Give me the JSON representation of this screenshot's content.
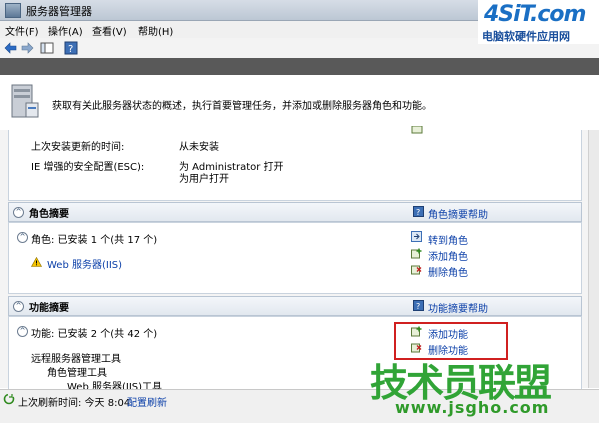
{
  "window": {
    "title": "服务器管理器"
  },
  "menu": {
    "items": [
      "文件(F)",
      "操作(A)",
      "查看(V)",
      "帮助(H)"
    ]
  },
  "logo": {
    "main": "4SiT.com",
    "sub": "电脑软硬件应用网"
  },
  "description": "获取有关此服务器状态的概述，执行首要管理任务，并添加或删除服务器角色和功能。",
  "security": {
    "last_update_label": "上次安装更新的时间:",
    "last_update_value": "从未安装",
    "ie_esc_label": "IE 增强的安全配置(ESC):",
    "ie_esc_value_line1": "为 Administrator 打开",
    "ie_esc_value_line2": "为用户打开"
  },
  "roles": {
    "header": "角色摘要",
    "help_link": "角色摘要帮助",
    "count_text": "角色: 已安装 1 个(共 17 个)",
    "items": [
      "Web 服务器(IIS)"
    ],
    "actions": [
      "转到角色",
      "添加角色",
      "删除角色"
    ]
  },
  "features": {
    "header": "功能摘要",
    "help_link": "功能摘要帮助",
    "count_text": "功能: 已安装 2 个(共 42 个)",
    "items": [
      "远程服务器管理工具",
      "角色管理工具",
      "Web 服务器(IIS)工具"
    ],
    "actions": [
      "添加功能",
      "删除功能"
    ]
  },
  "status": {
    "refresh_label": "上次刷新时间: 今天 8:04",
    "configure_link": "配置刷新"
  },
  "watermark": {
    "main": "技术员联盟",
    "url": "www.jsgho.com"
  },
  "colors": {
    "link": "#0b3fa8",
    "highlight_box": "#d02020",
    "watermark": "#27a02d"
  }
}
